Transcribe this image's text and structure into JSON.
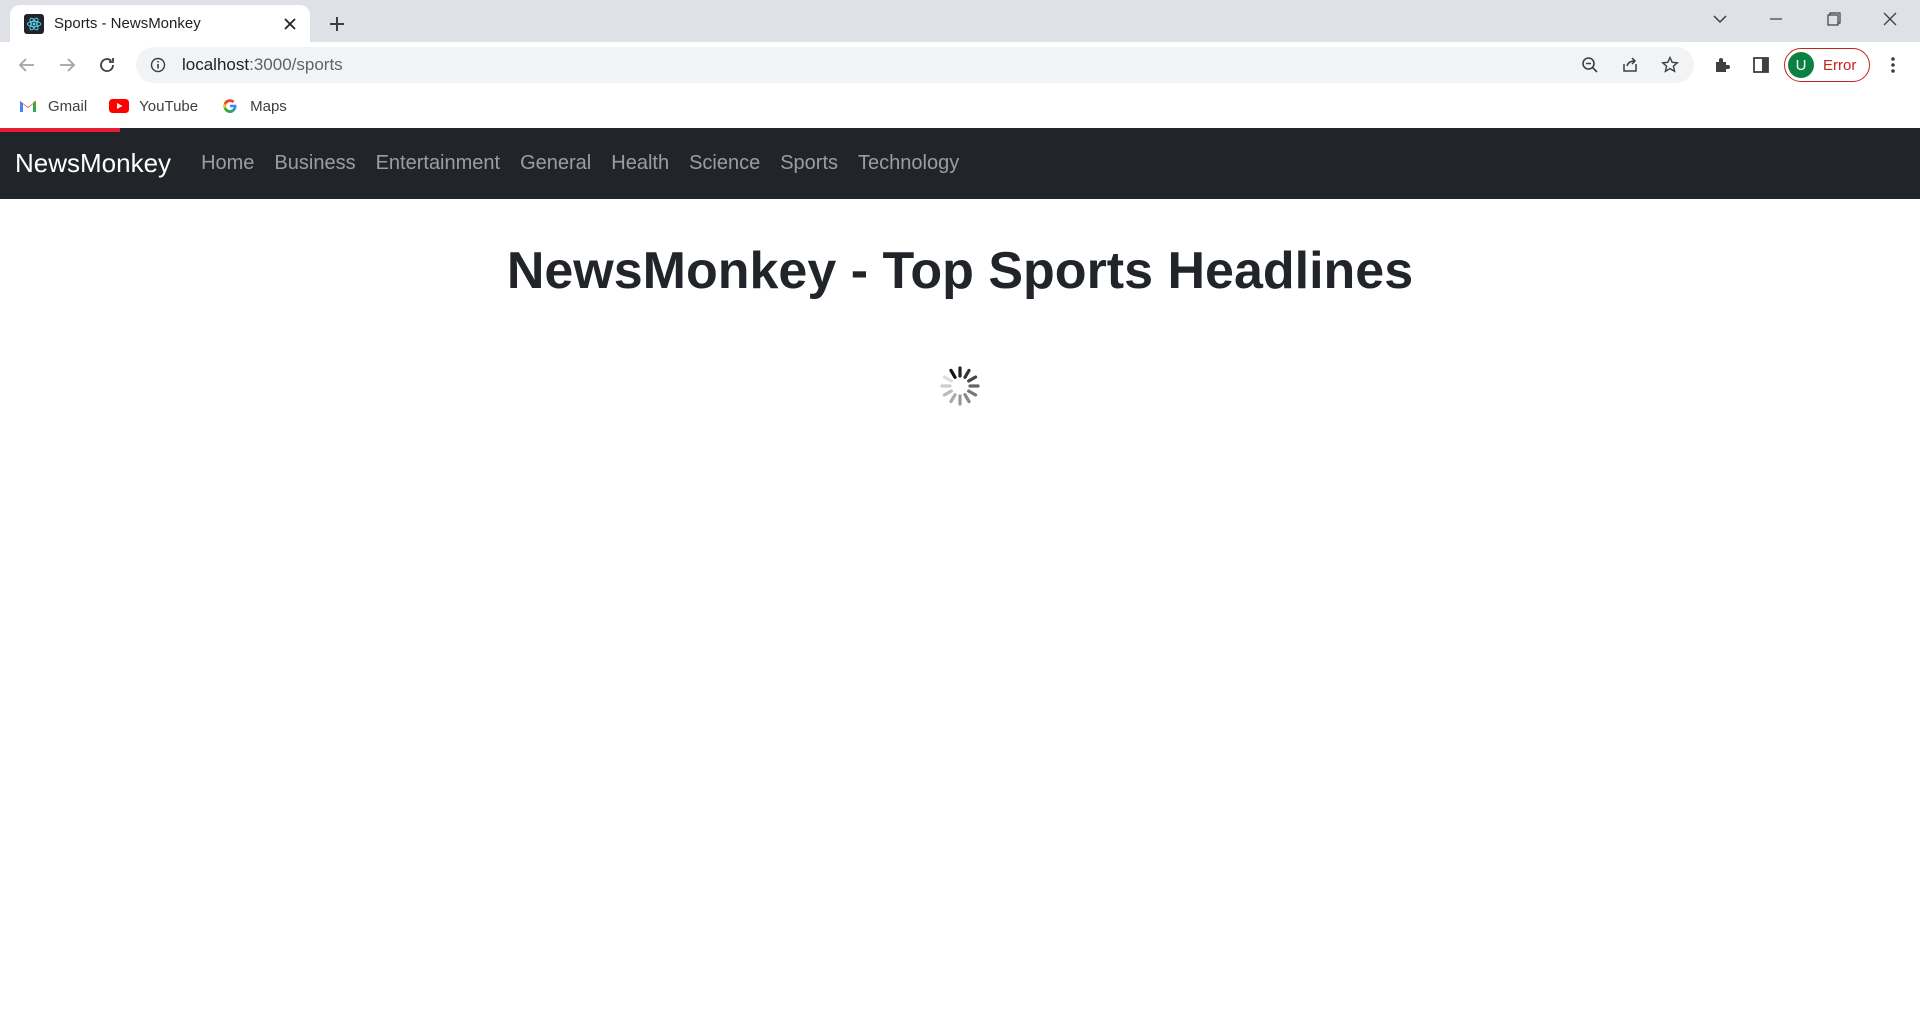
{
  "browser": {
    "tab": {
      "title": "Sports - NewsMonkey",
      "favicon": "react-icon"
    },
    "address": {
      "host": "localhost",
      "path": ":3000/sports"
    },
    "profile": {
      "initial": "U",
      "status": "Error"
    },
    "bookmarks": [
      {
        "label": "Gmail",
        "icon": "gmail-icon"
      },
      {
        "label": "YouTube",
        "icon": "youtube-icon"
      },
      {
        "label": "Maps",
        "icon": "google-icon"
      }
    ],
    "colors": {
      "tabstrip": "#dee1e6",
      "omnibox": "#f1f3f4",
      "profile_error": "#c5221f",
      "avatar": "#0b8043"
    }
  },
  "navbar": {
    "brand": "NewsMonkey",
    "links": [
      "Home",
      "Business",
      "Entertainment",
      "General",
      "Health",
      "Science",
      "Sports",
      "Technology"
    ],
    "colors": {
      "background": "#212529",
      "loading_bar": "#e71d36"
    }
  },
  "main": {
    "heading": "NewsMonkey - Top Sports Headlines",
    "status": "loading-spinner"
  }
}
